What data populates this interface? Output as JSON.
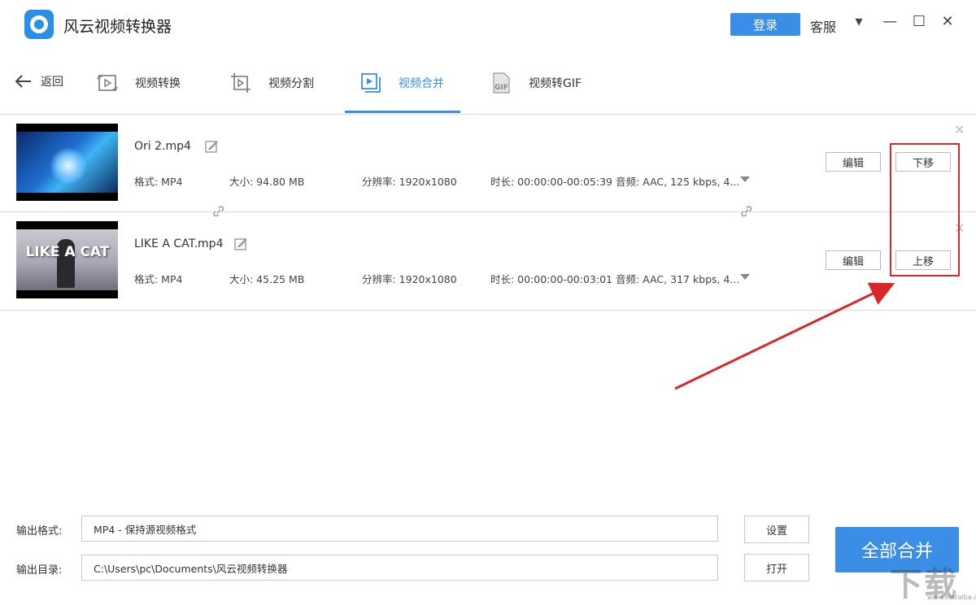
{
  "app": {
    "title": "风云视频转换器"
  },
  "header": {
    "login_label": "登录",
    "service_label": "客服",
    "menu_glyph": "▾",
    "minimize_glyph": "—",
    "maximize_glyph": "☐",
    "close_glyph": "✕"
  },
  "nav": {
    "back_label": "返回",
    "tabs": [
      {
        "label": "视频转换",
        "icon": "video-convert-icon"
      },
      {
        "label": "视频分割",
        "icon": "video-split-icon"
      },
      {
        "label": "视频合并",
        "icon": "video-merge-icon",
        "active": true
      },
      {
        "label": "视频转GIF",
        "icon": "video-gif-icon"
      }
    ],
    "accent_color": "#3a8ee6"
  },
  "files": [
    {
      "name": "Ori 2.mp4",
      "format": "格式: MP4",
      "size": "大小: 94.80 MB",
      "resolution": "分辨率: 1920x1080",
      "duration": "时长: 00:00:00-00:05:39",
      "audio": "音频: AAC, 125 kbps, 4...",
      "edit_label": "编辑",
      "move_label": "下移"
    },
    {
      "name": "LIKE A CAT.mp4",
      "thumb_text": "LIKE A CAT",
      "format": "格式: MP4",
      "size": "大小: 45.25 MB",
      "resolution": "分辨率: 1920x1080",
      "duration": "时长: 00:00:00-00:03:01",
      "audio": "音频: AAC, 317 kbps, 4...",
      "edit_label": "编辑",
      "move_label": "上移"
    }
  ],
  "output": {
    "format_label": "输出格式:",
    "format_value": "MP4 - 保持源视频格式",
    "settings_label": "设置",
    "dir_label": "输出目录:",
    "dir_value": "C:\\Users\\pc\\Documents\\风云视频转换器",
    "open_label": "打开"
  },
  "merge_all_label": "全部合并",
  "annotation_color": "#d8262a",
  "watermark": {
    "text": "下载",
    "url": "www.xiazaiba.com"
  }
}
